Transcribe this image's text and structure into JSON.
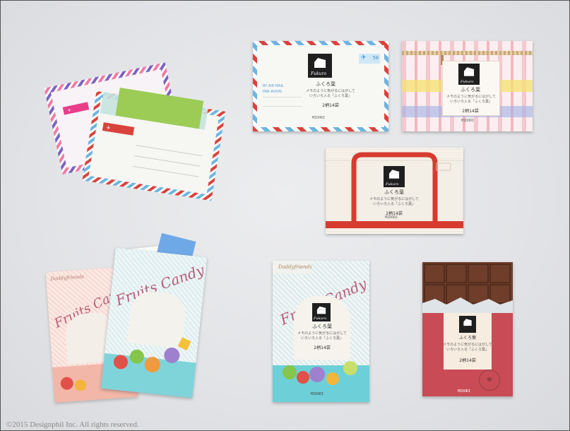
{
  "copyright": "©2015 Designphil Inc. All rights reserved.",
  "product": {
    "brand_label": "Fukuro",
    "name_jp": "ふくろ葉",
    "desc_line1": "メモのように気がるにはがして",
    "desc_line2": "いろいろ入る「ふくろ葉」",
    "count_label": "2柄14袋",
    "maker": "MIDORI"
  },
  "airmail": {
    "label": "AIR MAIL",
    "addr_line1": "BY AIR MAIL",
    "addr_line2": "PAR AVION",
    "stamp_value": "50"
  },
  "candy": {
    "brand": "Daddyfriends",
    "title": "Fruits Candy"
  },
  "colors": {
    "airmail_red": "#d9433c",
    "airmail_blue": "#6cb5e0",
    "candy_pink": "#f2b7a9",
    "candy_teal": "#6dd0d8",
    "chocolate": "#6e3e2b",
    "tote_red": "#d73b2f",
    "product_black": "#1f1f1f"
  }
}
